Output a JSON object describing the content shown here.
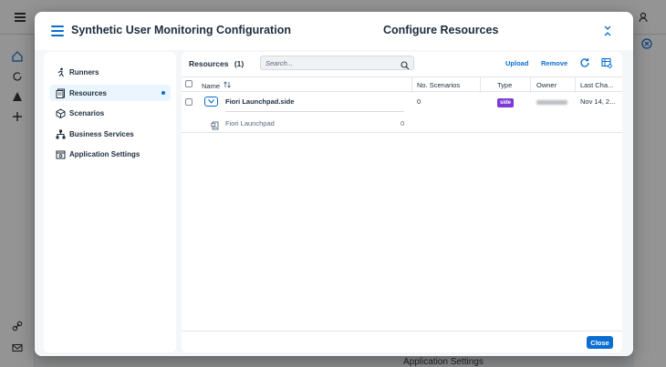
{
  "background": {
    "bottom_text": "Application Settings"
  },
  "header": {
    "app_title": "Synthetic User Monitoring Configuration",
    "page_title": "Configure Resources"
  },
  "nav": {
    "items": [
      {
        "label": "Runners",
        "icon": "runner-icon"
      },
      {
        "label": "Resources",
        "icon": "resources-icon",
        "active": true
      },
      {
        "label": "Scenarios",
        "icon": "scenarios-icon"
      },
      {
        "label": "Business Services",
        "icon": "hierarchy-icon"
      },
      {
        "label": "Application Settings",
        "icon": "settings-icon"
      }
    ]
  },
  "resources": {
    "title": "Resources",
    "count": "(1)",
    "search_placeholder": "Search...",
    "upload_label": "Upload",
    "remove_label": "Remove",
    "columns": {
      "name": "Name",
      "scenarios": "No. Scenarios",
      "type": "Type",
      "owner": "Owner",
      "last_changed": "Last Cha..."
    },
    "rows": [
      {
        "name": "Fiori Launchpad.side",
        "scenarios": "0",
        "type": "side",
        "last_changed": "Nov 14, 2...",
        "children": [
          {
            "name": "Fiori Launchpad",
            "count": "0"
          }
        ]
      }
    ]
  },
  "footer": {
    "close_label": "Close"
  },
  "colors": {
    "accent": "#0a6ed1",
    "badge": "#7b3bd6"
  }
}
